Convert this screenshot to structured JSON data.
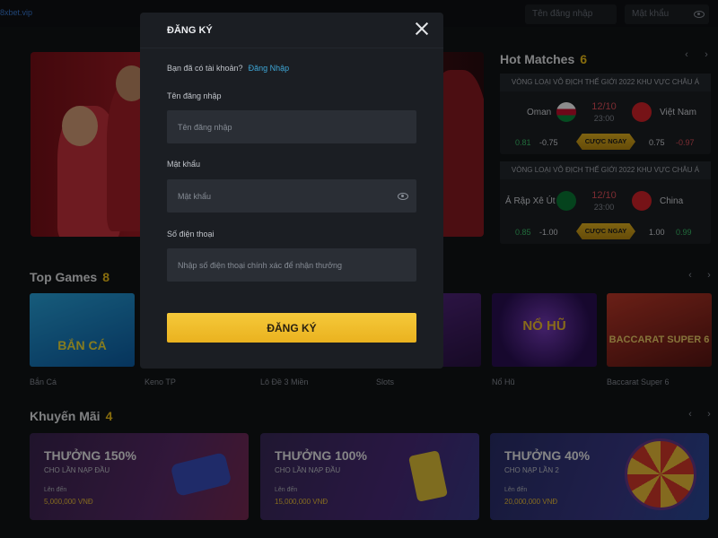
{
  "topbar": {
    "logo_text": "8xbet.vip",
    "username_placeholder": "Tên đăng nhập",
    "password_placeholder": "Mật khẩu"
  },
  "hot_matches": {
    "title": "Hot Matches",
    "count": "6",
    "matches": [
      {
        "league": "VÒNG LOẠI VÔ ĐỊCH THẾ GIỚI 2022 KHU VỰC CHÂU Á",
        "home": "Oman",
        "away": "Việt Nam",
        "date": "12/10",
        "time": "23:00",
        "odds": [
          "0.81",
          "-0.75",
          "0.75",
          "-0.97"
        ],
        "bet_label": "CƯỢC NGAY"
      },
      {
        "league": "VÒNG LOẠI VÔ ĐỊCH THẾ GIỚI 2022 KHU VỰC CHÂU Á",
        "home": "Ả Rập Xê Út",
        "away": "China",
        "date": "12/10",
        "time": "23:00",
        "odds": [
          "0.85",
          "-1.00",
          "1.00",
          "0.99"
        ],
        "bet_label": "CƯỢC NGAY"
      }
    ]
  },
  "top_games": {
    "title": "Top Games",
    "count": "8",
    "items": [
      {
        "label": "Bắn Cá",
        "art": "BẮN CÁ"
      },
      {
        "label": "Keno TP",
        "art": ""
      },
      {
        "label": "Lô Đề 3 Miền",
        "art": ""
      },
      {
        "label": "Slots",
        "art": ""
      },
      {
        "label": "Nổ Hũ",
        "art": "NỔ HŨ"
      },
      {
        "label": "Baccarat Super 6",
        "art": "BACCARAT SUPER 6"
      }
    ]
  },
  "promotions": {
    "title": "Khuyến Mãi",
    "count": "4",
    "items": [
      {
        "title": "THƯỞNG 150%",
        "subtitle": "CHO LẦN NẠP ĐẦU",
        "upto": "Lên đến",
        "amount": "5,000,000 VNĐ"
      },
      {
        "title": "THƯỞNG 100%",
        "subtitle": "CHO LẦN NẠP ĐẦU",
        "upto": "Lên đến",
        "amount": "15,000,000 VNĐ"
      },
      {
        "title": "THƯỞNG 40%",
        "subtitle": "CHO NẠP LẦN 2",
        "upto": "Lên đến",
        "amount": "20,000,000 VNĐ"
      }
    ]
  },
  "modal": {
    "title": "ĐĂNG KÝ",
    "has_account": "Bạn đã có tài khoản?",
    "login_link": "Đăng Nhập",
    "username_label": "Tên đăng nhập",
    "username_placeholder": "Tên đăng nhập",
    "password_label": "Mật khẩu",
    "password_placeholder": "Mật khẩu",
    "phone_label": "Số điện thoại",
    "phone_placeholder": "Nhập số điện thoại chính xác để nhận thưởng",
    "submit_label": "ĐĂNG KÝ"
  },
  "colors": {
    "accent": "#f5c518",
    "link": "#3ea6d6",
    "odd_up": "#3bc16a",
    "odd_down": "#e0505a"
  }
}
